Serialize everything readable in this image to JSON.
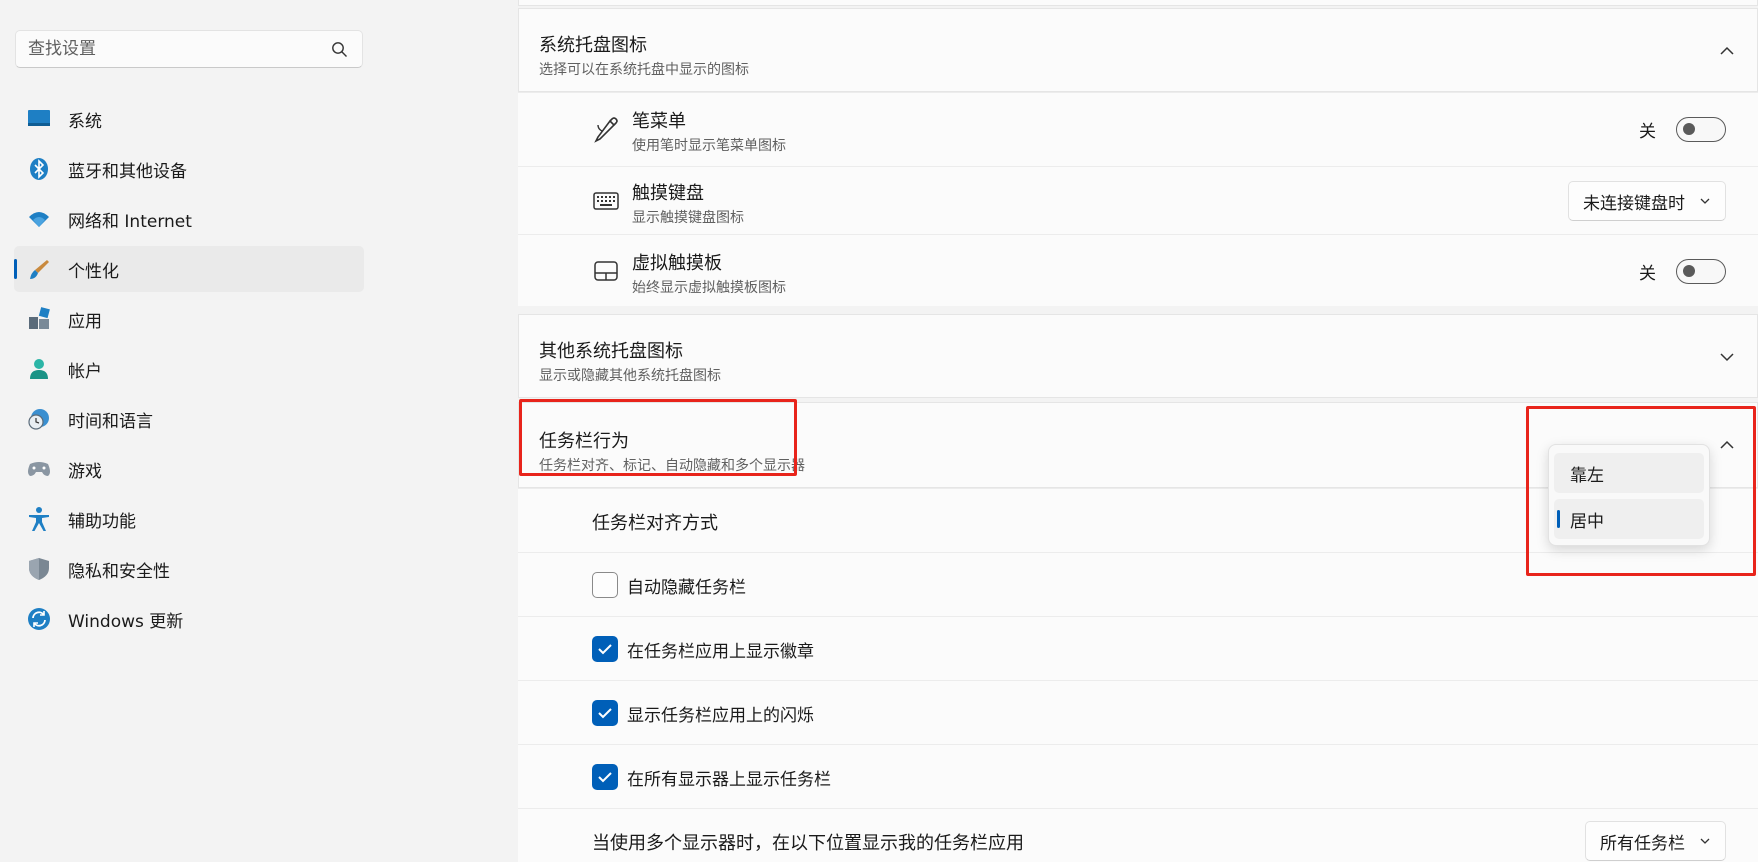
{
  "sidebar": {
    "search_placeholder": "查找设置",
    "items": [
      {
        "label": "系统",
        "icon": "system-monitor-icon"
      },
      {
        "label": "蓝牙和其他设备",
        "icon": "bluetooth-icon"
      },
      {
        "label": "网络和 Internet",
        "icon": "wifi-icon"
      },
      {
        "label": "个性化",
        "icon": "brush-icon",
        "active": true
      },
      {
        "label": "应用",
        "icon": "apps-icon"
      },
      {
        "label": "帐户",
        "icon": "account-icon"
      },
      {
        "label": "时间和语言",
        "icon": "clock-globe-icon"
      },
      {
        "label": "游戏",
        "icon": "gamepad-icon"
      },
      {
        "label": "辅助功能",
        "icon": "accessibility-icon"
      },
      {
        "label": "隐私和安全性",
        "icon": "shield-icon"
      },
      {
        "label": "Windows 更新",
        "icon": "update-icon"
      }
    ]
  },
  "tray_icons": {
    "title": "系统托盘图标",
    "subtitle": "选择可以在系统托盘中显示的图标",
    "items": [
      {
        "title": "笔菜单",
        "subtitle": "使用笔时显示笔菜单图标",
        "control": "toggle",
        "state_label": "关",
        "on": false,
        "icon": "pen-icon"
      },
      {
        "title": "触摸键盘",
        "subtitle": "显示触摸键盘图标",
        "control": "dropdown",
        "value": "未连接键盘时",
        "icon": "keyboard-icon"
      },
      {
        "title": "虚拟触摸板",
        "subtitle": "始终显示虚拟触摸板图标",
        "control": "toggle",
        "state_label": "关",
        "on": false,
        "icon": "touchpad-icon"
      }
    ]
  },
  "other_tray": {
    "title": "其他系统托盘图标",
    "subtitle": "显示或隐藏其他系统托盘图标"
  },
  "taskbar_behavior": {
    "title": "任务栏行为",
    "subtitle": "任务栏对齐、标记、自动隐藏和多个显示器",
    "alignment_label": "任务栏对齐方式",
    "alignment_options": [
      "靠左",
      "居中"
    ],
    "alignment_selected": "居中",
    "checkboxes": [
      {
        "label": "自动隐藏任务栏",
        "checked": false
      },
      {
        "label": "在任务栏应用上显示徽章",
        "checked": true
      },
      {
        "label": "显示任务栏应用上的闪烁",
        "checked": true
      },
      {
        "label": "在所有显示器上显示任务栏",
        "checked": true
      }
    ],
    "multi_display_label": "当使用多个显示器时，在以下位置显示我的任务栏应用",
    "multi_display_value": "所有任务栏"
  },
  "colors": {
    "accent": "#005fb8",
    "highlight_box": "#e8241b"
  }
}
